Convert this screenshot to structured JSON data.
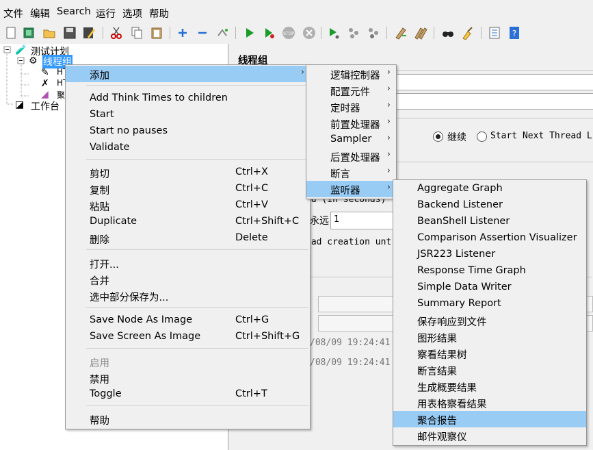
{
  "menubar": [
    "文件",
    "编辑",
    "Search",
    "运行",
    "选项",
    "帮助"
  ],
  "toolbar_icons": [
    "new-icon",
    "templates-icon",
    "open-icon",
    "save-icon",
    "save-as-icon",
    "cut-icon",
    "copy-icon",
    "paste-icon",
    "expand-icon",
    "collapse-icon",
    "toggle-icon",
    "start-icon",
    "start-no-pauses-icon",
    "stop-icon",
    "shutdown-icon",
    "remote-start-icon",
    "remote-stop-icon",
    "remote-shutdown-icon",
    "clear-icon",
    "clear-all-icon",
    "search-icon",
    "reset-search-icon",
    "function-helper-icon",
    "help-icon"
  ],
  "tree": {
    "test_plan": "测试计划",
    "thread_group": "线程组",
    "child1": "HT",
    "child2": "HT",
    "child3": "聚",
    "workbench": "工作台"
  },
  "right_panel": {
    "title": "线程组",
    "continue_label": "继续",
    "start_next_label": "Start Next Thread L",
    "ramp_text": "od (in seconds)",
    "loop_label": "永远",
    "loop_value": "1",
    "delay_text": "ead creation unt",
    "date1": "/08/09 19:24:41",
    "date2": "/08/09 19:24:41"
  },
  "context_menu": {
    "add": "添加",
    "add_think_times": "Add Think Times to children",
    "start": "Start",
    "start_no_pauses": "Start no pauses",
    "validate": "Validate",
    "cut": "剪切",
    "cut_acc": "Ctrl+X",
    "copy": "复制",
    "copy_acc": "Ctrl+C",
    "paste": "粘贴",
    "paste_acc": "Ctrl+V",
    "duplicate": "Duplicate",
    "duplicate_acc": "Ctrl+Shift+C",
    "delete": "删除",
    "delete_acc": "Delete",
    "open": "打开...",
    "merge": "合并",
    "save_selection": "选中部分保存为...",
    "save_node_image": "Save Node As Image",
    "save_node_image_acc": "Ctrl+G",
    "save_screen_image": "Save Screen As Image",
    "save_screen_image_acc": "Ctrl+Shift+G",
    "enable": "启用",
    "disable": "禁用",
    "toggle": "Toggle",
    "toggle_acc": "Ctrl+T",
    "help": "帮助"
  },
  "add_submenu": [
    "逻辑控制器",
    "配置元件",
    "定时器",
    "前置处理器",
    "Sampler",
    "后置处理器",
    "断言",
    "监听器"
  ],
  "listener_submenu": [
    "Aggregate Graph",
    "Backend Listener",
    "BeanShell Listener",
    "Comparison Assertion Visualizer",
    "JSR223 Listener",
    "Response Time Graph",
    "Simple Data Writer",
    "Summary Report",
    "保存响应到文件",
    "图形结果",
    "察看结果树",
    "断言结果",
    "生成概要结果",
    "用表格察看结果",
    "聚合报告",
    "邮件观察仪"
  ],
  "colors": {
    "highlight": "#99ccf5",
    "selected_tree": "#3399ff"
  }
}
